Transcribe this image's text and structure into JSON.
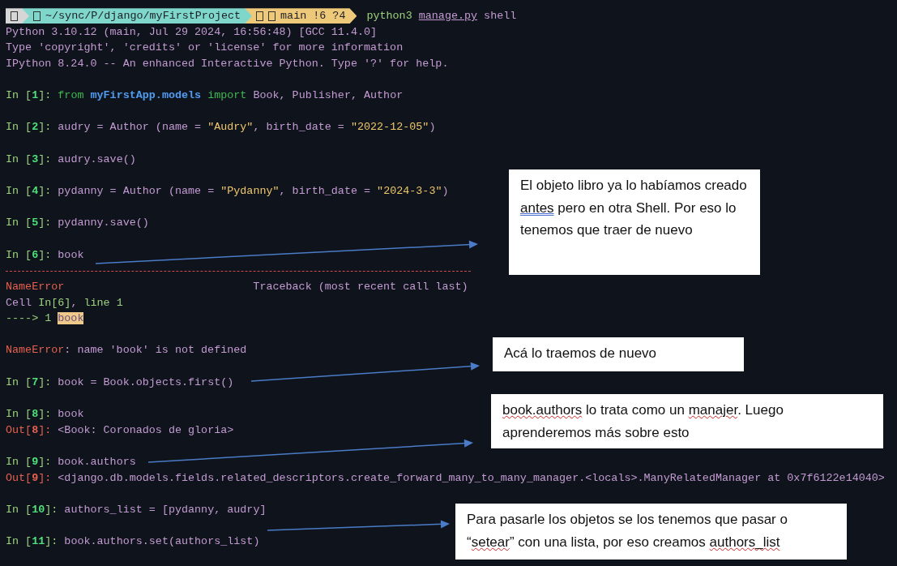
{
  "prompt_bar": {
    "segments": [
      {
        "kind": "os"
      },
      {
        "kind": "path",
        "text": "~/sync/P/django/myFirstProject"
      },
      {
        "kind": "git",
        "text": "main !6 ?4"
      }
    ],
    "command": [
      {
        "kind": "cmd",
        "text": "python3"
      },
      {
        "kind": "link",
        "text": "manage.py"
      },
      {
        "kind": "text",
        "text": "shell"
      }
    ]
  },
  "lines": [
    {
      "kind": "output",
      "parts": [
        {
          "kind": "text",
          "text": "Python 3.10.12 (main, Jul 29 2024, 16:56:48) [GCC 11.4.0]"
        }
      ]
    },
    {
      "kind": "output",
      "parts": [
        {
          "kind": "text",
          "text": "Type 'copyright', 'credits' or 'license' for more information"
        }
      ]
    },
    {
      "kind": "output",
      "parts": [
        {
          "kind": "text",
          "text": "IPython 8.24.0 -- An enhanced Interactive Python. Type '?' for help."
        }
      ]
    },
    {
      "kind": "blank"
    },
    {
      "kind": "input",
      "parts": [
        {
          "kind": "prompt",
          "text": "In ["
        },
        {
          "kind": "num",
          "text": "1"
        },
        {
          "kind": "prompt",
          "text": "]: "
        },
        {
          "kind": "keyword",
          "text": "from "
        },
        {
          "kind": "module",
          "text": "myFirstApp.models "
        },
        {
          "kind": "keyword",
          "text": "import "
        },
        {
          "kind": "text",
          "text": "Book, Publisher, Author"
        }
      ]
    },
    {
      "kind": "blank"
    },
    {
      "kind": "input",
      "parts": [
        {
          "kind": "prompt",
          "text": "In ["
        },
        {
          "kind": "num",
          "text": "2"
        },
        {
          "kind": "prompt",
          "text": "]: "
        },
        {
          "kind": "text",
          "text": "audry = Author (name = "
        },
        {
          "kind": "string",
          "text": "\"Audry\""
        },
        {
          "kind": "text",
          "text": ", birth_date = "
        },
        {
          "kind": "string",
          "text": "\"2022-12-05\""
        },
        {
          "kind": "text",
          "text": ")"
        }
      ]
    },
    {
      "kind": "blank"
    },
    {
      "kind": "input",
      "parts": [
        {
          "kind": "prompt",
          "text": "In ["
        },
        {
          "kind": "num",
          "text": "3"
        },
        {
          "kind": "prompt",
          "text": "]: "
        },
        {
          "kind": "text",
          "text": "audry.save()"
        }
      ]
    },
    {
      "kind": "blank"
    },
    {
      "kind": "input",
      "parts": [
        {
          "kind": "prompt",
          "text": "In ["
        },
        {
          "kind": "num",
          "text": "4"
        },
        {
          "kind": "prompt",
          "text": "]: "
        },
        {
          "kind": "text",
          "text": "pydanny = Author (name = "
        },
        {
          "kind": "string",
          "text": "\"Pydanny\""
        },
        {
          "kind": "text",
          "text": ", birth_date = "
        },
        {
          "kind": "string",
          "text": "\"2024-3-3\""
        },
        {
          "kind": "text",
          "text": ")"
        }
      ]
    },
    {
      "kind": "blank"
    },
    {
      "kind": "input",
      "parts": [
        {
          "kind": "prompt",
          "text": "In ["
        },
        {
          "kind": "num",
          "text": "5"
        },
        {
          "kind": "prompt",
          "text": "]: "
        },
        {
          "kind": "text",
          "text": "pydanny.save()"
        }
      ]
    },
    {
      "kind": "blank"
    },
    {
      "kind": "input",
      "parts": [
        {
          "kind": "prompt",
          "text": "In ["
        },
        {
          "kind": "num",
          "text": "6"
        },
        {
          "kind": "prompt",
          "text": "]: "
        },
        {
          "kind": "text",
          "text": "book"
        }
      ]
    },
    {
      "kind": "rule"
    },
    {
      "kind": "split",
      "parts": [
        {
          "kind": "error",
          "text": "NameError"
        },
        {
          "kind": "text",
          "text": "Traceback (most recent call last)"
        }
      ]
    },
    {
      "kind": "output",
      "parts": [
        {
          "kind": "text",
          "text": "Cell "
        },
        {
          "kind": "prompt",
          "text": "In[6]"
        },
        {
          "kind": "text",
          "text": ", "
        },
        {
          "kind": "prompt",
          "text": "line 1"
        }
      ]
    },
    {
      "kind": "output",
      "parts": [
        {
          "kind": "prompt",
          "text": "----> 1 "
        },
        {
          "kind": "highlight",
          "text": "book"
        }
      ]
    },
    {
      "kind": "blank"
    },
    {
      "kind": "output",
      "parts": [
        {
          "kind": "error",
          "text": "NameError"
        },
        {
          "kind": "text",
          "text": ": name 'book' is not defined"
        }
      ]
    },
    {
      "kind": "blank"
    },
    {
      "kind": "input",
      "parts": [
        {
          "kind": "prompt",
          "text": "In ["
        },
        {
          "kind": "num",
          "text": "7"
        },
        {
          "kind": "prompt",
          "text": "]: "
        },
        {
          "kind": "text",
          "text": "book = Book.objects.first()"
        }
      ]
    },
    {
      "kind": "blank"
    },
    {
      "kind": "input",
      "parts": [
        {
          "kind": "prompt",
          "text": "In ["
        },
        {
          "kind": "num",
          "text": "8"
        },
        {
          "kind": "prompt",
          "text": "]: "
        },
        {
          "kind": "text",
          "text": "book"
        }
      ]
    },
    {
      "kind": "output",
      "parts": [
        {
          "kind": "error",
          "text": "Out["
        },
        {
          "kind": "errnum",
          "text": "8"
        },
        {
          "kind": "error",
          "text": "]: "
        },
        {
          "kind": "text",
          "text": "<Book: Coronados de gloria>"
        }
      ]
    },
    {
      "kind": "blank"
    },
    {
      "kind": "input",
      "parts": [
        {
          "kind": "prompt",
          "text": "In ["
        },
        {
          "kind": "num",
          "text": "9"
        },
        {
          "kind": "prompt",
          "text": "]: "
        },
        {
          "kind": "text",
          "text": "book.authors"
        }
      ]
    },
    {
      "kind": "output",
      "parts": [
        {
          "kind": "error",
          "text": "Out["
        },
        {
          "kind": "errnum",
          "text": "9"
        },
        {
          "kind": "error",
          "text": "]: "
        },
        {
          "kind": "text",
          "text": "<django.db.models.fields.related_descriptors.create_forward_many_to_many_manager.<locals>.ManyRelatedManager at 0x7f6122e14040>"
        }
      ]
    },
    {
      "kind": "blank"
    },
    {
      "kind": "input",
      "parts": [
        {
          "kind": "prompt",
          "text": "In ["
        },
        {
          "kind": "num",
          "text": "10"
        },
        {
          "kind": "prompt",
          "text": "]: "
        },
        {
          "kind": "text",
          "text": "authors_list = [pydanny, audry]"
        }
      ]
    },
    {
      "kind": "blank"
    },
    {
      "kind": "input",
      "parts": [
        {
          "kind": "prompt",
          "text": "In ["
        },
        {
          "kind": "num",
          "text": "11"
        },
        {
          "kind": "prompt",
          "text": "]: "
        },
        {
          "kind": "text",
          "text": "book.authors.set(authors_list)"
        }
      ]
    }
  ],
  "notes": [
    {
      "parts": [
        {
          "text": "El objeto libro ya lo habíamos creado "
        },
        {
          "text": "antes",
          "kind": "grammar"
        },
        {
          "text": " pero en otra Shell. Por eso lo tenemos que traer de nuevo"
        }
      ]
    },
    {
      "parts": [
        {
          "text": "Acá lo traemos de nuevo"
        }
      ]
    },
    {
      "parts": [
        {
          "text": "book.authors",
          "kind": "spelling"
        },
        {
          "text": " lo trata como un "
        },
        {
          "text": "manajer",
          "kind": "spelling"
        },
        {
          "text": ". Luego aprenderemos más sobre esto"
        }
      ]
    },
    {
      "parts": [
        {
          "text": "Para pasarle los objetos se los tenemos que pasar o “"
        },
        {
          "text": "setear",
          "kind": "spelling"
        },
        {
          "text": "” con una lista, por eso creamos "
        },
        {
          "text": "authors_list",
          "kind": "spelling"
        }
      ]
    }
  ]
}
